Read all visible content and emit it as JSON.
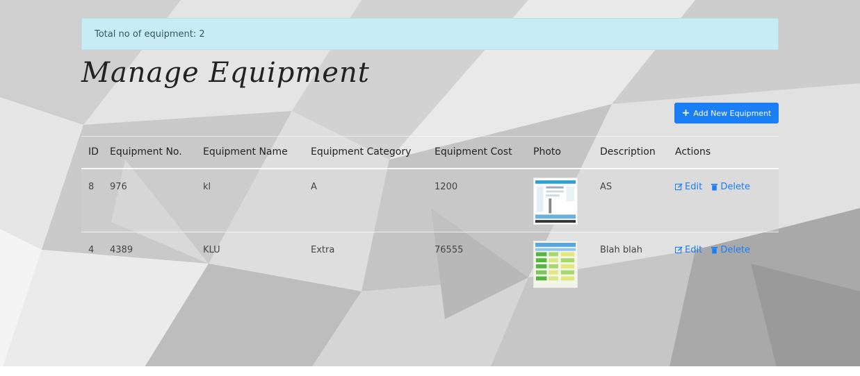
{
  "alert": {
    "text": "Total no of equipment: 2"
  },
  "page": {
    "title": "Manage Equipment"
  },
  "toolbar": {
    "add_label": "Add New Equipment",
    "add_icon": "plus-icon"
  },
  "table": {
    "headers": [
      "ID",
      "Equipment No.",
      "Equipment Name",
      "Equipment Category",
      "Equipment Cost",
      "Photo",
      "Description",
      "Actions"
    ],
    "rows": [
      {
        "id": "8",
        "number": "976",
        "name": "kl",
        "category": "A",
        "cost": "1200",
        "description": "AS",
        "edit": "Edit",
        "delete": "Delete"
      },
      {
        "id": "4",
        "number": "4389",
        "name": "KLU",
        "category": "Extra",
        "cost": "76555",
        "description": "Blah blah",
        "edit": "Edit",
        "delete": "Delete"
      }
    ]
  },
  "colors": {
    "accent": "#1a7ef5",
    "alert_bg": "#c8ecf3"
  }
}
